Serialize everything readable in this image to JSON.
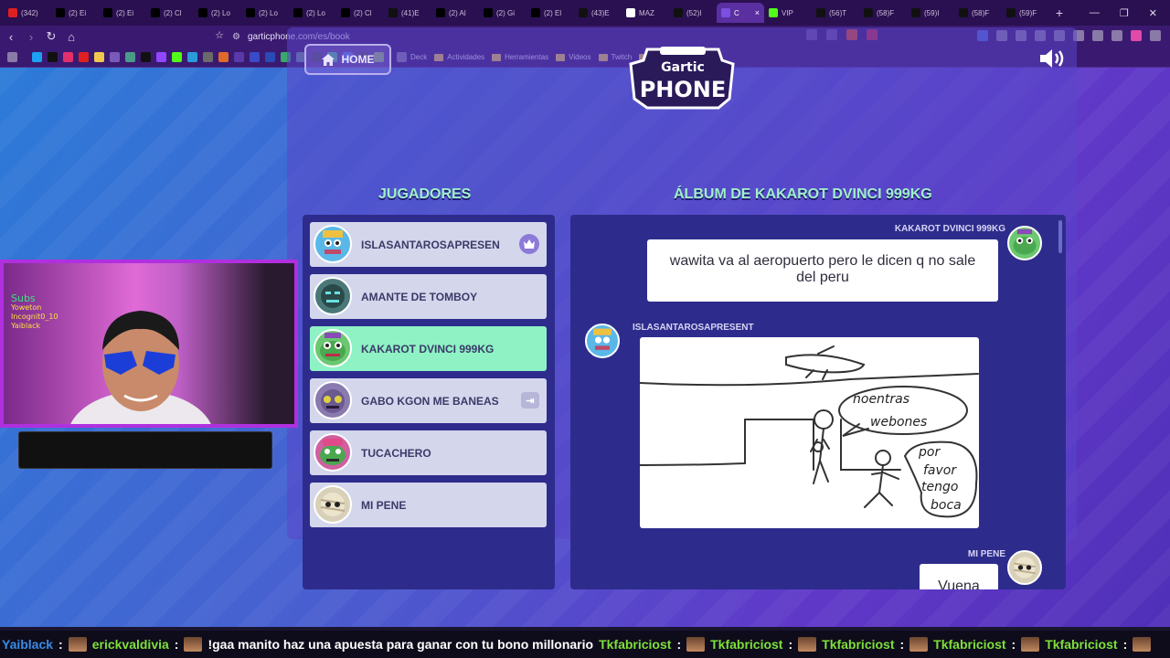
{
  "browser": {
    "tabs": [
      {
        "label": "(342)",
        "icon": "youtube-icon",
        "color": "#e02020"
      },
      {
        "label": "(2) Ei",
        "icon": "x-icon",
        "color": "#000000"
      },
      {
        "label": "(2) Ei",
        "icon": "x-icon",
        "color": "#000000"
      },
      {
        "label": "(2) Cl",
        "icon": "x-icon",
        "color": "#000000"
      },
      {
        "label": "(2) Lo",
        "icon": "x-icon",
        "color": "#000000"
      },
      {
        "label": "(2) Lo",
        "icon": "x-icon",
        "color": "#000000"
      },
      {
        "label": "(2) Lo",
        "icon": "x-icon",
        "color": "#000000"
      },
      {
        "label": "(2) Cl",
        "icon": "x-icon",
        "color": "#000000"
      },
      {
        "label": "(41)E",
        "icon": "tiktok-icon",
        "color": "#111111"
      },
      {
        "label": "(2) Al",
        "icon": "x-icon",
        "color": "#000000"
      },
      {
        "label": "(2) Gi",
        "icon": "x-icon",
        "color": "#000000"
      },
      {
        "label": "(2) El",
        "icon": "x-icon",
        "color": "#000000"
      },
      {
        "label": "(43)E",
        "icon": "tiktok-icon",
        "color": "#111111"
      },
      {
        "label": "MAZ",
        "icon": "google-icon",
        "color": "#ffffff"
      },
      {
        "label": "(52)I",
        "icon": "tiktok-icon",
        "color": "#111111"
      },
      {
        "label": "C",
        "icon": "gartic-icon",
        "color": "#7b4fe0",
        "active": true
      },
      {
        "label": "VIP",
        "icon": "kick-icon",
        "color": "#53fc18"
      },
      {
        "label": "(56)T",
        "icon": "tiktok-icon",
        "color": "#111111"
      },
      {
        "label": "(58)F",
        "icon": "tiktok-icon",
        "color": "#111111"
      },
      {
        "label": "(59)I",
        "icon": "tiktok-icon",
        "color": "#111111"
      },
      {
        "label": "(58)F",
        "icon": "tiktok-icon",
        "color": "#111111"
      },
      {
        "label": "(59)F",
        "icon": "tiktok-icon",
        "color": "#111111"
      }
    ],
    "url": "garticphone.com/es/book",
    "bookmarks": [
      {
        "label": "Deck",
        "icon": "deck-icon"
      },
      {
        "label": "Actividades",
        "icon": "folder-icon"
      },
      {
        "label": "Herramientas",
        "icon": "folder-icon"
      },
      {
        "label": "Videos",
        "icon": "folder-icon"
      },
      {
        "label": "Twitch",
        "icon": "folder-icon"
      },
      {
        "label": "Partners",
        "icon": "folder-icon"
      }
    ]
  },
  "header": {
    "home_label": "HOME",
    "logo_top": "Gartic",
    "logo_bottom": "PHONE"
  },
  "players_panel": {
    "title": "JUGADORES",
    "players": [
      {
        "name": "ISLASANTAROSAPRESEN",
        "host": true,
        "avatar_color": "#5ab8e8"
      },
      {
        "name": "AMANTE DE TOMBOY",
        "avatar_color": "#4a7878"
      },
      {
        "name": "KAKAROT DVINCI 999KG",
        "active": true,
        "avatar_color": "#6bc870"
      },
      {
        "name": "GABO KGON ME BANEAS",
        "kick": true,
        "avatar_color": "#8a7ab0"
      },
      {
        "name": "TUCACHERO",
        "avatar_color": "#d060a0"
      },
      {
        "name": "MI PENE",
        "avatar_color": "#d8d0b8"
      }
    ]
  },
  "album": {
    "title": "ÁLBUM DE KAKAROT DVINCI 999KG",
    "entries": [
      {
        "author": "KAKAROT DVINCI 999KG",
        "text": "wawita va al aeropuerto pero le dicen q no sale del peru"
      },
      {
        "author": "ISLASANTAROSAPRESENT",
        "drawing": true
      },
      {
        "author": "MI PENE",
        "text": "Vuena"
      }
    ]
  },
  "stream": {
    "cam_lines": [
      "Subs",
      "Yoweton",
      "Incognit0_10",
      "Yaiblack"
    ],
    "ticker": [
      {
        "user": "Yaiblack",
        "color": "#3a8ce8",
        "msg": ""
      },
      {
        "user": "erickvaldivia",
        "color": "#7ee03a",
        "msg": "!gaa manito haz una apuesta para ganar con tu bono millonario"
      },
      {
        "user": "Tkfabriciost",
        "color": "#7ee03a",
        "msg": ""
      },
      {
        "user": "Tkfabriciost",
        "color": "#7ee03a",
        "msg": ""
      },
      {
        "user": "Tkfabriciost",
        "color": "#7ee03a",
        "msg": ""
      },
      {
        "user": "Tkfabriciost",
        "color": "#7ee03a",
        "msg": ""
      },
      {
        "user": "Tkfabriciost",
        "color": "#7ee03a",
        "msg": ""
      }
    ]
  }
}
